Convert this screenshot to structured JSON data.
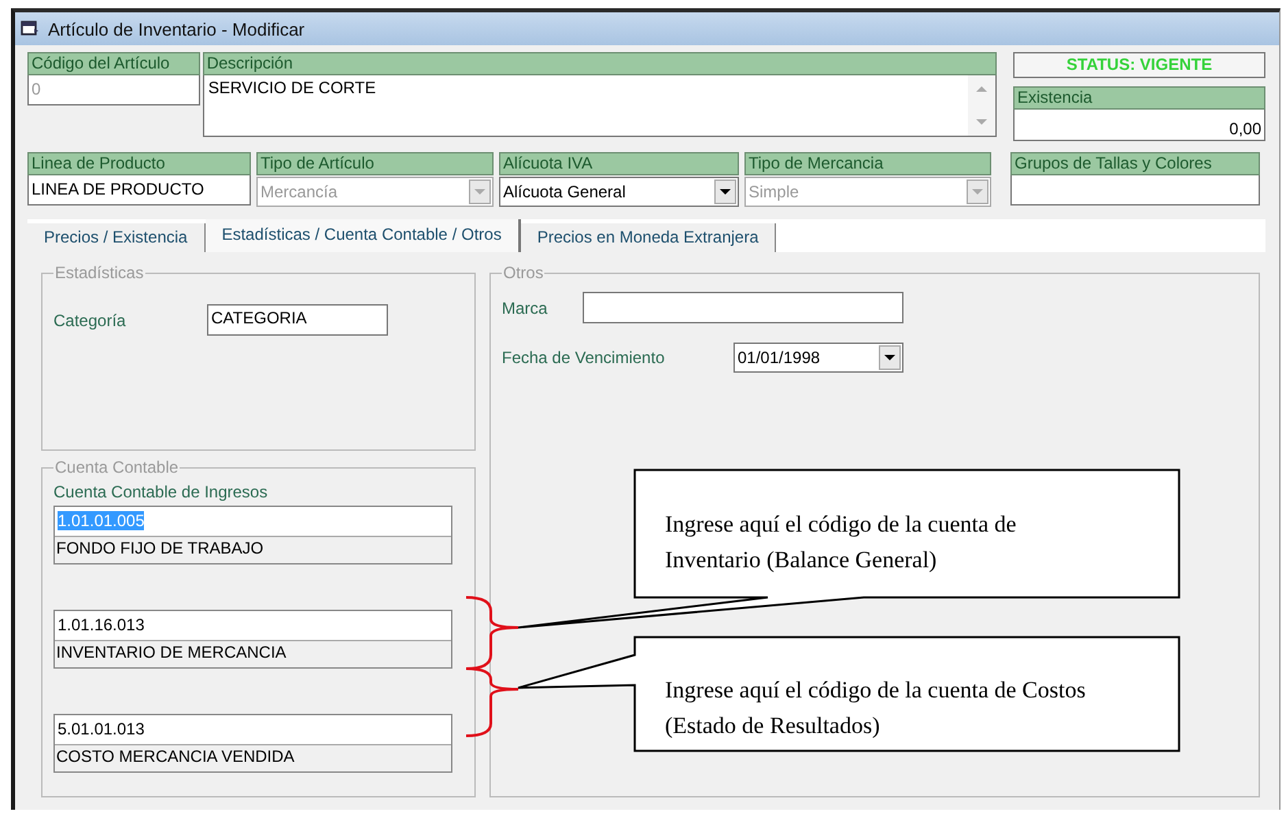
{
  "window": {
    "title": "Artículo de Inventario - Modificar"
  },
  "header_row": [
    {
      "kind": "text",
      "label": "Código del Artículo",
      "value": "0",
      "disabled": true
    },
    {
      "kind": "textarea",
      "label": "Descripción",
      "value": "SERVICIO DE CORTE",
      "disabled": false
    }
  ],
  "status": "STATUS: VIGENTE",
  "existencia": {
    "label": "Existencia",
    "value": "0,00"
  },
  "second_row": [
    {
      "kind": "text",
      "label": "Linea de Producto",
      "value": "LINEA DE PRODUCTO",
      "disabled": false
    },
    {
      "kind": "combo",
      "label": "Tipo de Artículo",
      "value": "Mercancía",
      "disabled": true
    },
    {
      "kind": "combo",
      "label": "Alícuota IVA",
      "value": "Alícuota General",
      "disabled": false
    },
    {
      "kind": "combo",
      "label": "Tipo de Mercancia",
      "value": "Simple",
      "disabled": true
    }
  ],
  "grupos": {
    "label": "Grupos de Tallas y Colores"
  },
  "tabs": [
    {
      "label": "Precios / Existencia",
      "selected": false
    },
    {
      "label": "Estadísticas / Cuenta Contable / Otros",
      "selected": true
    },
    {
      "label": "Precios en Moneda Extranjera",
      "selected": false
    }
  ],
  "estadisticas": {
    "legend": "Estadísticas",
    "label": "Categoría",
    "value": "CATEGORIA"
  },
  "cuenta_contable": {
    "legend": "Cuenta Contable",
    "label": "Cuenta Contable de Ingresos",
    "accounts": [
      {
        "code": "1.01.01.005",
        "name": "FONDO FIJO DE TRABAJO",
        "selected": true
      },
      {
        "code": "1.01.16.013",
        "name": "INVENTARIO DE MERCANCIA",
        "selected": false
      },
      {
        "code": "5.01.01.013",
        "name": "COSTO MERCANCIA VENDIDA",
        "selected": false
      }
    ]
  },
  "otros": {
    "legend": "Otros",
    "marca_label": "Marca",
    "fecha_label": "Fecha de Vencimiento",
    "fecha_value": "01/01/1998"
  },
  "callouts": [
    {
      "text": "Ingrese aquí el código de la cuenta de Inventario (Balance General)"
    },
    {
      "text": "Ingrese aquí el código de la cuenta de Costos (Estado de Resultados)"
    }
  ]
}
